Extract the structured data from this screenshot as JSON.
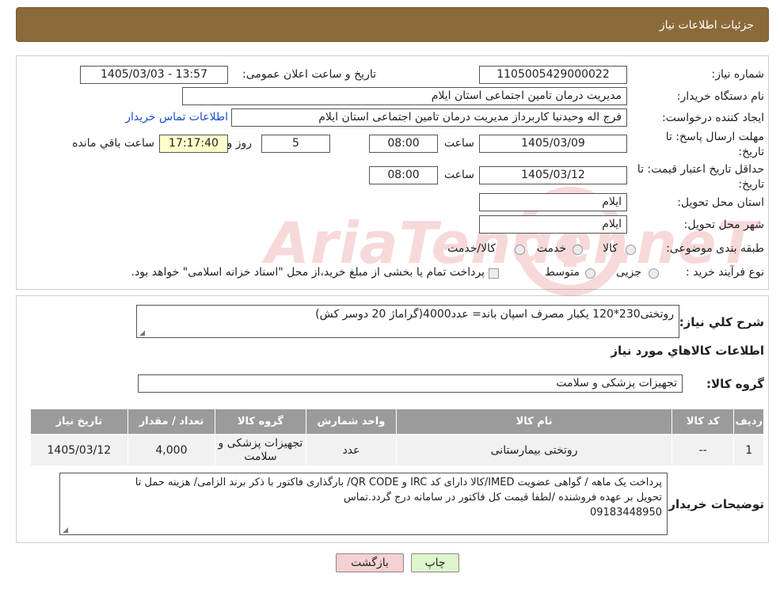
{
  "header": {
    "title": "جزئیات اطلاعات نیاز"
  },
  "form": {
    "need_number_label": "شماره نیاز:",
    "need_number": "1105005429000022",
    "announce_label": "تاریخ و ساعت اعلان عمومی:",
    "announce_value": "1405/03/03 - 13:57",
    "buyer_org_label": "نام دستگاه خریدار:",
    "buyer_org": "مدیریت درمان تامین اجتماعی استان ایلام",
    "creator_label": "ایجاد کننده درخواست:",
    "creator": "فرج اله وحیدنیا کاربرداز مدیریت درمان تامین اجتماعی استان ایلام",
    "contact_link": "اطلاعات تماس خریدار",
    "deadline_label_1": "مهلت ارسال پاسخ: تا",
    "deadline_label_2": "تاریخ:",
    "deadline_date": "1405/03/09",
    "time_label": "ساعت",
    "deadline_time": "08:00",
    "days_value": "5",
    "days_label": "روز و",
    "remaining_time": "17:17:40",
    "remaining_label": "ساعت باقي مانده",
    "validity_label_1": "حداقل تاریخ اعتبار قیمت: تا",
    "validity_label_2": "تاریخ:",
    "validity_date": "1405/03/12",
    "validity_time_label": "ساعت",
    "validity_time": "08:00",
    "province_label": "استان محل تحویل:",
    "province": "ایلام",
    "city_label": "شهر محل تحویل:",
    "city": "ایلام",
    "category_label": "طبقه بندی موضوعی:",
    "category_options": [
      "کالا",
      "خدمت",
      "کالا/خدمت"
    ],
    "process_label": "نوع فرآیند خرید :",
    "process_options": [
      "جزیی",
      "متوسط"
    ],
    "process_note": "پرداخت تمام یا بخشی از مبلغ خرید،از محل \"اسناد خزانه اسلامی\" خواهد بود."
  },
  "watermark": {
    "text": "AriaTender.neT"
  },
  "details": {
    "summary_label": "شرح کلي نياز:",
    "summary": "روتختی230*120 یکبار مصرف اسپان باند= عدد4000(گراماژ 20 دوسر کش)",
    "items_heading": "اطلاعات کالاهاي مورد نياز",
    "group_label": "گروه کالا:",
    "group_value": "تجهیزات پزشکی و سلامت"
  },
  "table": {
    "headers": [
      "ردیف",
      "کد کالا",
      "نام کالا",
      "واحد شمارش",
      "گروه کالا",
      "تعداد / مقدار",
      "تاریخ نیاز"
    ],
    "rows": [
      [
        "1",
        "--",
        "روتختی بیمارستانی",
        "عدد",
        "تجهیزات پزشکی و سلامت",
        "4,000",
        "1405/03/12"
      ]
    ]
  },
  "notes": {
    "label": "توضیحات خریدار:",
    "line1": "پرداخت یک ماهه / گواهی عضویت IMED/کالا دارای کد IRC  و QR CODE/ بارگذاری فاکتور با ذکر برند الزامی/ هزینه حمل تا",
    "line2": "تحویل بر عهده فروشنده /لطفا قیمت کل فاکتور در سامانه درج گردد.تماس",
    "line3": "09183448950"
  },
  "buttons": {
    "back": "بازگشت",
    "print": "چاپ"
  },
  "colors": {
    "header_bg": "#8b6a3a",
    "remaining_bg": "#ffffcc",
    "back_bg": "#f5d1d1",
    "print_bg": "#dff5cc",
    "table_header": "#9b9b9b"
  }
}
